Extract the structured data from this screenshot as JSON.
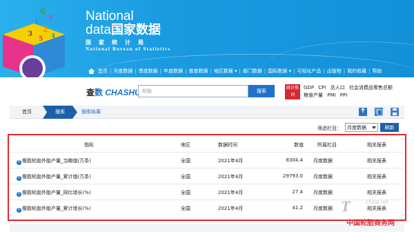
{
  "colors": {
    "header_blue": "#1aa1e6",
    "nav_dark_blue": "#1d5fa8",
    "highlight_red": "#e0262c",
    "link_blue": "#1e73c8"
  },
  "brand": {
    "line1": "National",
    "line2_en": "data",
    "line2_cn": "国家数据",
    "sub_cn": "国家统计局",
    "sub_en": "National Bureau of Statistics",
    "digits": [
      "6",
      "7",
      "1",
      "2",
      "3",
      "4",
      "5"
    ]
  },
  "nav": {
    "items": [
      "首页",
      "月度数据",
      "季度数据",
      "年度数据",
      "普查数据",
      "地区数据 ▾",
      "部门数据",
      "国际数据 ▾",
      "可视化产品",
      "出版物",
      "我的收藏",
      "帮助"
    ]
  },
  "search": {
    "logo_cha": "查",
    "logo_shu": "数",
    "logo_en": "CHASHU",
    "query": "轮胎",
    "button_label": "搜索",
    "hot_badge": "统计热词",
    "hot_words": [
      "GDP",
      "CPI",
      "总人口",
      "社会消费品零售总额",
      "粮食产量",
      "PMI",
      "PPI"
    ]
  },
  "breadcrumb": {
    "home": "首页",
    "active": "搜索",
    "result": "搜索结果"
  },
  "tool_icons": [
    "export-icon",
    "copy-icon",
    "print-icon"
  ],
  "filter": {
    "label": "筛选栏目：",
    "selected": "月度数据",
    "refresh_label": "刷新"
  },
  "table": {
    "columns": [
      "指标",
      "地区",
      "数据时间",
      "数值",
      "所属栏目",
      "相关报表"
    ],
    "rows": [
      {
        "indicator": "橡胶轮胎外胎产量_当期值(万条)",
        "region": "全国",
        "time": "2021年4月",
        "value": "8304.4",
        "category": "月度数据",
        "report": "相关报表"
      },
      {
        "indicator": "橡胶轮胎外胎产量_累计值(万条)",
        "region": "全国",
        "time": "2021年4月",
        "value": "29793.0",
        "category": "月度数据",
        "report": "相关报表"
      },
      {
        "indicator": "橡胶轮胎外胎产量_同比增长(%)",
        "region": "全国",
        "time": "2021年4月",
        "value": "27.4",
        "category": "月度数据",
        "report": "相关报表"
      },
      {
        "indicator": "橡胶轮胎外胎产量_累计增长(%)",
        "region": "全国",
        "time": "2021年4月",
        "value": "41.2",
        "category": "月度数据",
        "report": "相关报表"
      }
    ]
  },
  "watermark": {
    "logo": "T",
    "site": "china.net",
    "cn": "中国轮胎商务网"
  }
}
